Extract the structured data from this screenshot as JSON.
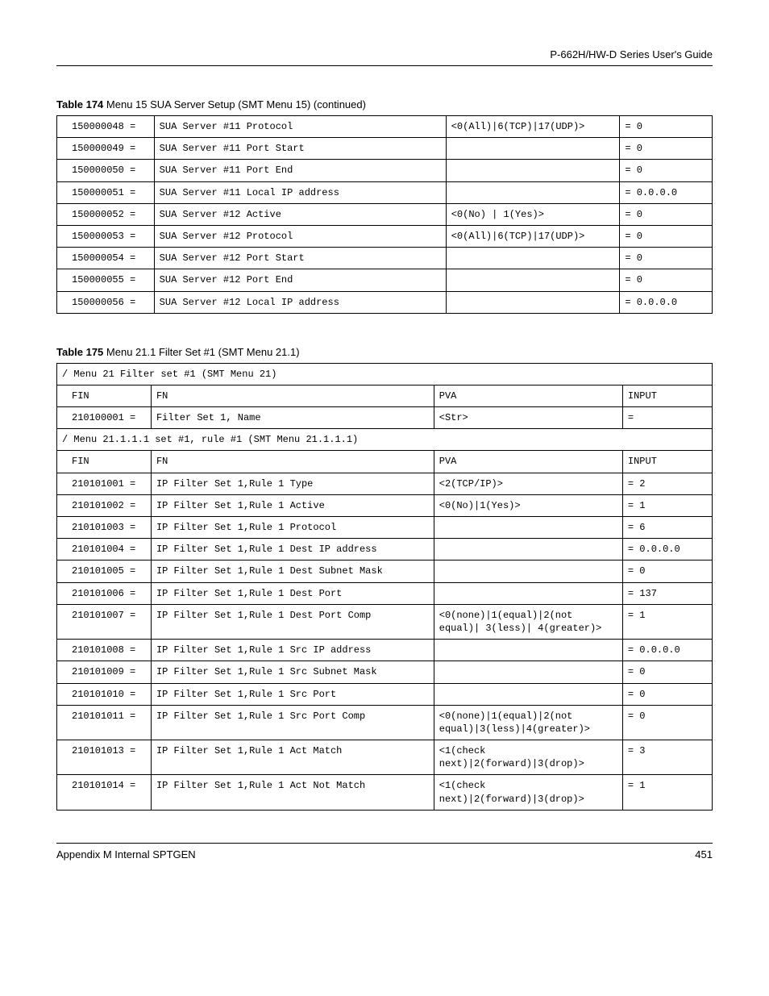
{
  "header": {
    "guide_title": "P-662H/HW-D Series User's Guide"
  },
  "table174": {
    "caption_bold": "Table 174",
    "caption_rest": "   Menu 15 SUA Server Setup (SMT Menu 15) (continued)",
    "rows": [
      {
        "fin": "150000048 =",
        "fn": "SUA Server #11 Protocol",
        "pva": "<0(All)|6(TCP)|17(UDP)>",
        "input": "= 0"
      },
      {
        "fin": "150000049 =",
        "fn": "SUA Server #11 Port Start",
        "pva": "",
        "input": "= 0"
      },
      {
        "fin": "150000050 =",
        "fn": "SUA Server #11 Port End",
        "pva": "",
        "input": "= 0"
      },
      {
        "fin": "150000051 =",
        "fn": "SUA Server #11 Local IP address",
        "pva": "",
        "input": "= 0.0.0.0"
      },
      {
        "fin": "150000052 =",
        "fn": "SUA Server #12 Active",
        "pva": "<0(No) | 1(Yes)>",
        "input": "= 0"
      },
      {
        "fin": "150000053 =",
        "fn": "SUA Server #12 Protocol",
        "pva": "<0(All)|6(TCP)|17(UDP)>",
        "input": "= 0"
      },
      {
        "fin": "150000054 =",
        "fn": "SUA Server #12 Port Start",
        "pva": "",
        "input": "= 0"
      },
      {
        "fin": "150000055 =",
        "fn": "SUA Server #12 Port End",
        "pva": "",
        "input": "= 0"
      },
      {
        "fin": "150000056 =",
        "fn": "SUA Server #12 Local IP address",
        "pva": "",
        "input": "= 0.0.0.0"
      }
    ]
  },
  "table175": {
    "caption_bold": "Table 175",
    "caption_rest": "   Menu 21.1 Filter Set #1 (SMT Menu 21.1)",
    "section1": "/ Menu 21 Filter set #1 (SMT Menu 21)",
    "header1": {
      "c1": "FIN",
      "c2": "FN",
      "c3": "PVA",
      "c4": "INPUT"
    },
    "row_name": {
      "fin": "210100001 =",
      "fn": "Filter Set 1, Name",
      "pva": "<Str>",
      "input": "="
    },
    "section2": "/ Menu 21.1.1.1 set #1, rule #1 (SMT Menu 21.1.1.1)",
    "header2": {
      "c1": "FIN",
      "c2": "FN",
      "c3": "PVA",
      "c4": "INPUT"
    },
    "rows": [
      {
        "fin": "210101001 =",
        "fn": "IP Filter Set 1,Rule 1 Type",
        "pva": "<2(TCP/IP)>",
        "input": "= 2"
      },
      {
        "fin": "210101002 =",
        "fn": "IP Filter Set 1,Rule 1 Active",
        "pva": "<0(No)|1(Yes)>",
        "input": "= 1"
      },
      {
        "fin": "210101003 =",
        "fn": "IP Filter Set 1,Rule 1 Protocol",
        "pva": "",
        "input": "= 6"
      },
      {
        "fin": "210101004 =",
        "fn": "IP Filter Set 1,Rule 1 Dest IP address",
        "pva": "",
        "input": "= 0.0.0.0"
      },
      {
        "fin": "210101005 =",
        "fn": "IP Filter Set 1,Rule 1 Dest Subnet Mask",
        "pva": "",
        "input": "= 0"
      },
      {
        "fin": "210101006 =",
        "fn": "IP Filter Set 1,Rule 1 Dest Port",
        "pva": "",
        "input": "= 137"
      },
      {
        "fin": "210101007 =",
        "fn": "IP Filter Set 1,Rule 1 Dest Port Comp",
        "pva": "<0(none)|1(equal)|2(not equal)| 3(less)| 4(greater)>",
        "input": "= 1"
      },
      {
        "fin": "210101008 =",
        "fn": "IP Filter Set 1,Rule 1 Src IP address",
        "pva": "",
        "input": "= 0.0.0.0"
      },
      {
        "fin": "210101009 =",
        "fn": "IP Filter Set 1,Rule 1 Src Subnet Mask",
        "pva": "",
        "input": "= 0"
      },
      {
        "fin": "210101010 =",
        "fn": "IP Filter Set 1,Rule 1 Src Port",
        "pva": "",
        "input": "= 0"
      },
      {
        "fin": "210101011 =",
        "fn": "IP Filter Set 1,Rule 1 Src Port Comp",
        "pva": "<0(none)|1(equal)|2(not equal)|3(less)|4(greater)>",
        "input": "= 0"
      },
      {
        "fin": "210101013 =",
        "fn": "IP Filter Set 1,Rule 1 Act Match",
        "pva": "<1(check next)|2(forward)|3(drop)>",
        "input": "= 3"
      },
      {
        "fin": "210101014 =",
        "fn": "IP Filter Set 1,Rule 1 Act Not Match",
        "pva": "<1(check next)|2(forward)|3(drop)>",
        "input": "= 1"
      }
    ]
  },
  "footer": {
    "left": "Appendix M Internal SPTGEN",
    "right": "451"
  }
}
